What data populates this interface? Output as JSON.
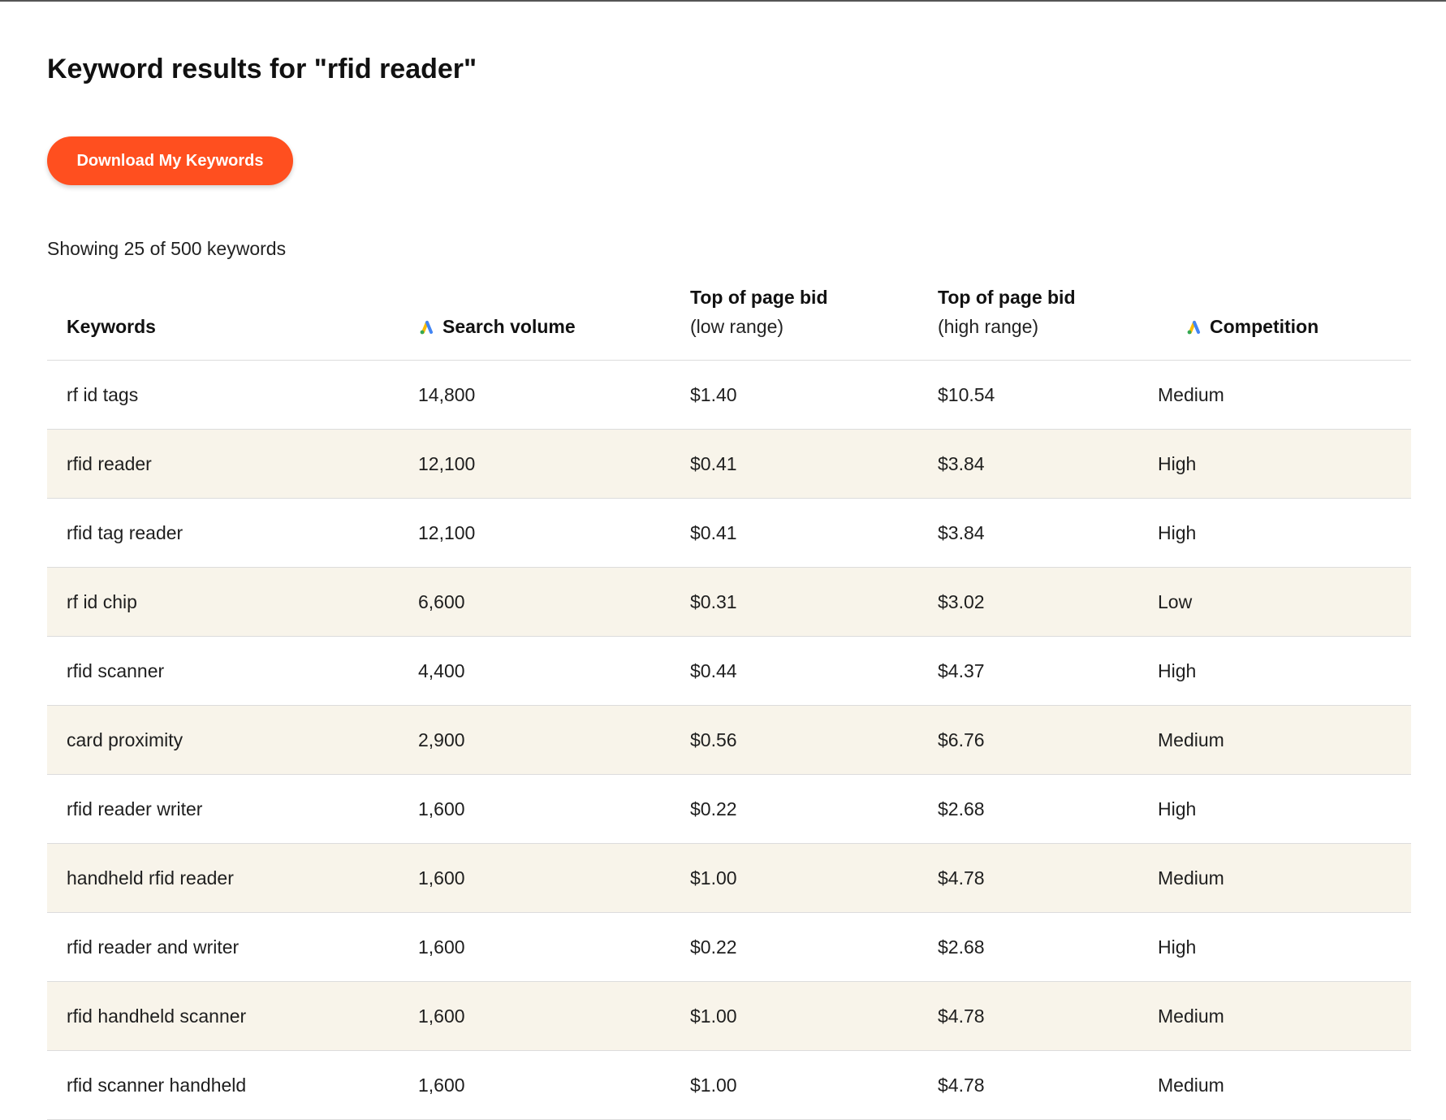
{
  "page": {
    "title": "Keyword results for \"rfid reader\"",
    "download_label": "Download My Keywords",
    "showing_text": "Showing 25 of 500 keywords"
  },
  "colors": {
    "accent": "#ff4f1f",
    "row_alt": "#f8f4ea",
    "google_ads_blue": "#4285f4",
    "google_ads_yellow": "#fbbc04",
    "google_ads_green": "#34a853"
  },
  "table": {
    "headers": {
      "keywords": "Keywords",
      "search_volume": "Search volume",
      "low_bid_line1": "Top of page bid",
      "low_bid_line2": "(low range)",
      "high_bid_line1": "Top of page bid",
      "high_bid_line2": "(high range)",
      "competition": "Competition"
    },
    "header_icons": {
      "search_volume": "google-ads-icon",
      "competition": "google-ads-icon"
    },
    "rows": [
      {
        "keyword": "rf id tags",
        "volume": "14,800",
        "low": "$1.40",
        "high": "$10.54",
        "competition": "Medium"
      },
      {
        "keyword": "rfid reader",
        "volume": "12,100",
        "low": "$0.41",
        "high": "$3.84",
        "competition": "High"
      },
      {
        "keyword": "rfid tag reader",
        "volume": "12,100",
        "low": "$0.41",
        "high": "$3.84",
        "competition": "High"
      },
      {
        "keyword": "rf id chip",
        "volume": "6,600",
        "low": "$0.31",
        "high": "$3.02",
        "competition": "Low"
      },
      {
        "keyword": "rfid scanner",
        "volume": "4,400",
        "low": "$0.44",
        "high": "$4.37",
        "competition": "High"
      },
      {
        "keyword": "card proximity",
        "volume": "2,900",
        "low": "$0.56",
        "high": "$6.76",
        "competition": "Medium"
      },
      {
        "keyword": "rfid reader writer",
        "volume": "1,600",
        "low": "$0.22",
        "high": "$2.68",
        "competition": "High"
      },
      {
        "keyword": "handheld rfid reader",
        "volume": "1,600",
        "low": "$1.00",
        "high": "$4.78",
        "competition": "Medium"
      },
      {
        "keyword": "rfid reader and writer",
        "volume": "1,600",
        "low": "$0.22",
        "high": "$2.68",
        "competition": "High"
      },
      {
        "keyword": "rfid handheld scanner",
        "volume": "1,600",
        "low": "$1.00",
        "high": "$4.78",
        "competition": "Medium"
      },
      {
        "keyword": "rfid scanner handheld",
        "volume": "1,600",
        "low": "$1.00",
        "high": "$4.78",
        "competition": "Medium"
      }
    ]
  }
}
